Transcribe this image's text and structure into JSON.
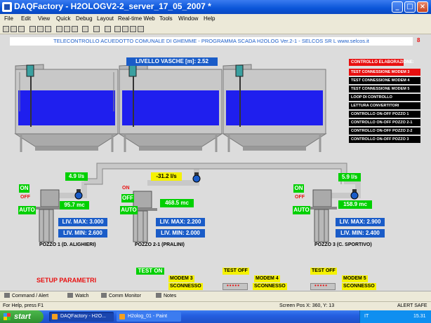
{
  "window": {
    "title": "DAQFactory - H2OLOGV2-2_server_17_05_2007 *"
  },
  "menu": [
    "File",
    "Edit",
    "View",
    "Quick",
    "Debug",
    "Layout",
    "Real-time Web",
    "Tools",
    "Window",
    "Help"
  ],
  "header": {
    "text": "TELECONTROLLO ACUEDOTTO COMUNALE DI GHEMME - PROGRAMMA SCADA H2OLOG Ver.2-1  -  SELCOS SR L  www.selcos.it",
    "page_number": "8"
  },
  "tanks": {
    "level_label": "LIVELLO VASCHE [m]: 2.52"
  },
  "control": {
    "header": "CONTROLLO ELABORAZIONE:",
    "items": [
      "TEST CONNESSIONE MODEM 3",
      "TEST CONNESSIONE MODEM 4",
      "TEST CONNESSIONE MODEM 5",
      "LOOP DI CONTROLLO",
      "LETTURA CONVERTITORI",
      "CONTROLLO ON-OFF POZZO 1",
      "CONTROLLO ON-OFF POZZO 2-1",
      "CONTROLLO ON-OFF POZZO 2-2",
      "CONTROLLO ON-OFF POZZO 3"
    ]
  },
  "wells": [
    {
      "name": "POZZO 1 (D. ALIGHIERI)",
      "on": "ON",
      "off": "OFF",
      "auto": "AUTO",
      "flow": "4.9 l/s",
      "volume": "95.7 mc",
      "liv_max": "LIV. MAX: 3.000",
      "liv_min": "LIV. MIN: 2.600"
    },
    {
      "name": "POZZO 2-1 (PRALINI)",
      "on": "ON",
      "off": "OFF",
      "auto": "AUTO",
      "flow": "-31.2 l/s",
      "volume": "468.5 mc",
      "liv_max": "LIV. MAX: 2.200",
      "liv_min": "LIV. MIN: 2.000"
    },
    {
      "name": "POZZO 3 (C. SPORTIVO)",
      "on": "ON",
      "off": "OFF",
      "auto": "AUTO",
      "flow": "5.9 l/s",
      "volume": "158.9 mc",
      "liv_max": "LIV. MAX: 2.900",
      "liv_min": "LIV. MIN: 2.400"
    }
  ],
  "setup": {
    "label": "SETUP PARAMETRI"
  },
  "modems": [
    {
      "status": "TEST ON",
      "name": "MODEM 3",
      "state": "SCONNESSO"
    },
    {
      "status": "TEST OFF",
      "name": "MODEM 4",
      "state": "SCONNESSO"
    },
    {
      "status": "TEST OFF",
      "name": "MODEM 5",
      "state": "SCONNESSO"
    }
  ],
  "tabs": [
    "Command / Alert",
    "Watch",
    "Comm Monitor",
    "Notes"
  ],
  "status": {
    "help": "For Help, press F1",
    "screen_pos": "Screen Pos X: 360, Y: 13",
    "alert": "ALERT SAFE"
  },
  "taskbar": {
    "start": "start",
    "tasks": [
      "DAQFactory - H2O...",
      "H2olog_01 - Paint"
    ],
    "tray_lang": "IT",
    "clock": "15.31"
  },
  "colors": {
    "titlebar": "#0a55d8",
    "water": "#1f1fee",
    "active_green": "#00d000",
    "alarm_red": "#e81010",
    "info_blue": "#1a5cc8",
    "note_yellow": "#f5f200"
  }
}
